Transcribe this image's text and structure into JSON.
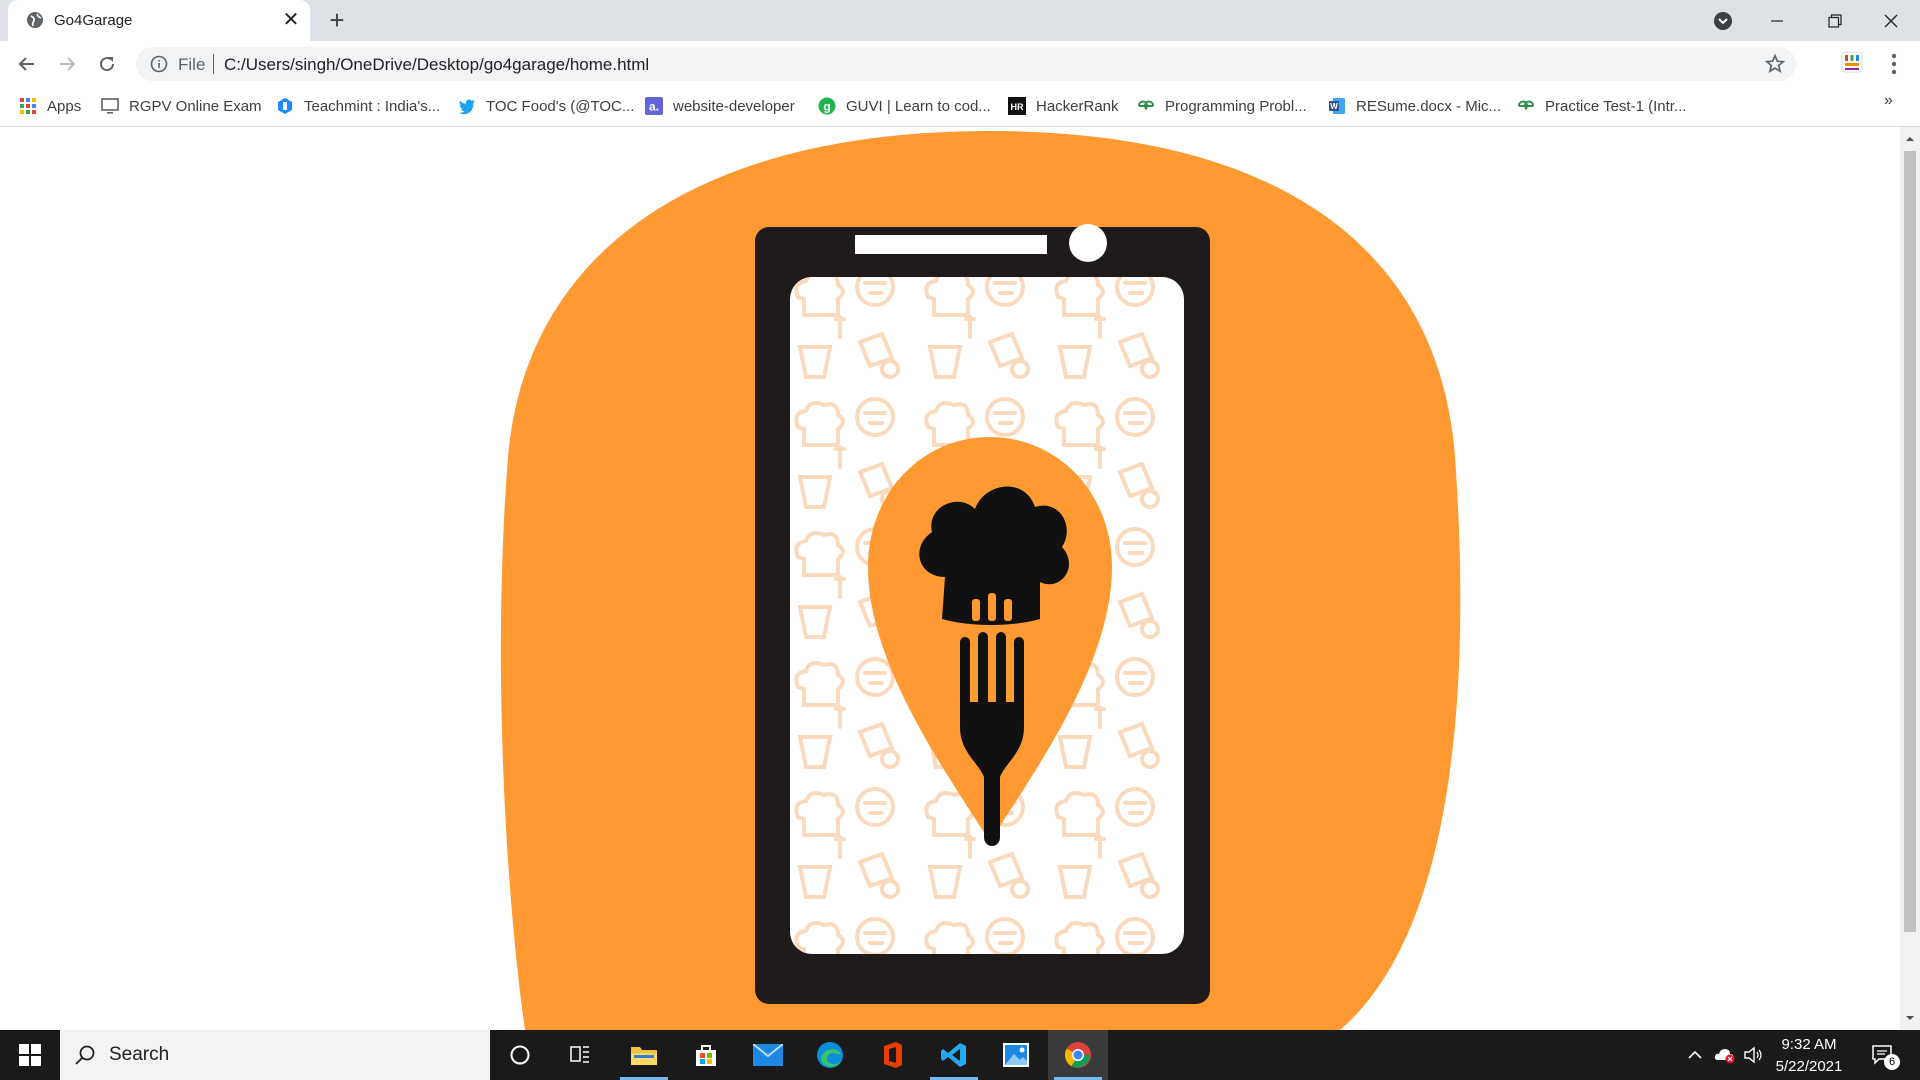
{
  "browser": {
    "tab": {
      "title": "Go4Garage",
      "close_label": "✕"
    },
    "new_tab_label": "+",
    "address": {
      "scheme": "File",
      "url": "C:/Users/singh/OneDrive/Desktop/go4garage/home.html"
    },
    "bookmarks": [
      {
        "label": "Apps",
        "icon": "apps-grid-icon",
        "color": "#4285f4"
      },
      {
        "label": "RGPV Online Exam",
        "icon": "monitor-icon",
        "color": "#5f6368"
      },
      {
        "label": "Teachmint : India's...",
        "icon": "teachmint-icon",
        "color": "#1a8cff"
      },
      {
        "label": "TOC Food's (@TOC...",
        "icon": "twitter-icon",
        "color": "#1da1f2"
      },
      {
        "label": "website-developer",
        "icon": "a-icon",
        "color": "#6366d9"
      },
      {
        "label": "GUVI | Learn to cod...",
        "icon": "guvi-icon",
        "color": "#22b14c"
      },
      {
        "label": "HackerRank",
        "icon": "hackerrank-icon",
        "color": "#000000"
      },
      {
        "label": "Programming Probl...",
        "icon": "gfg-icon",
        "color": "#2f8d46"
      },
      {
        "label": "RESume.docx - Mic...",
        "icon": "word-icon",
        "color": "#2b579a"
      },
      {
        "label": "Practice Test-1 (Intr...",
        "icon": "gfg-icon",
        "color": "#2f8d46"
      }
    ],
    "bookmarks_more": "»"
  },
  "page": {
    "brand_color": "#ff9a33",
    "phone_color": "#1f1b1b",
    "pattern_color": "#fbd9bd"
  },
  "taskbar": {
    "search_placeholder": "Search",
    "time": "9:32 AM",
    "date": "5/22/2021",
    "notifications": "6"
  }
}
